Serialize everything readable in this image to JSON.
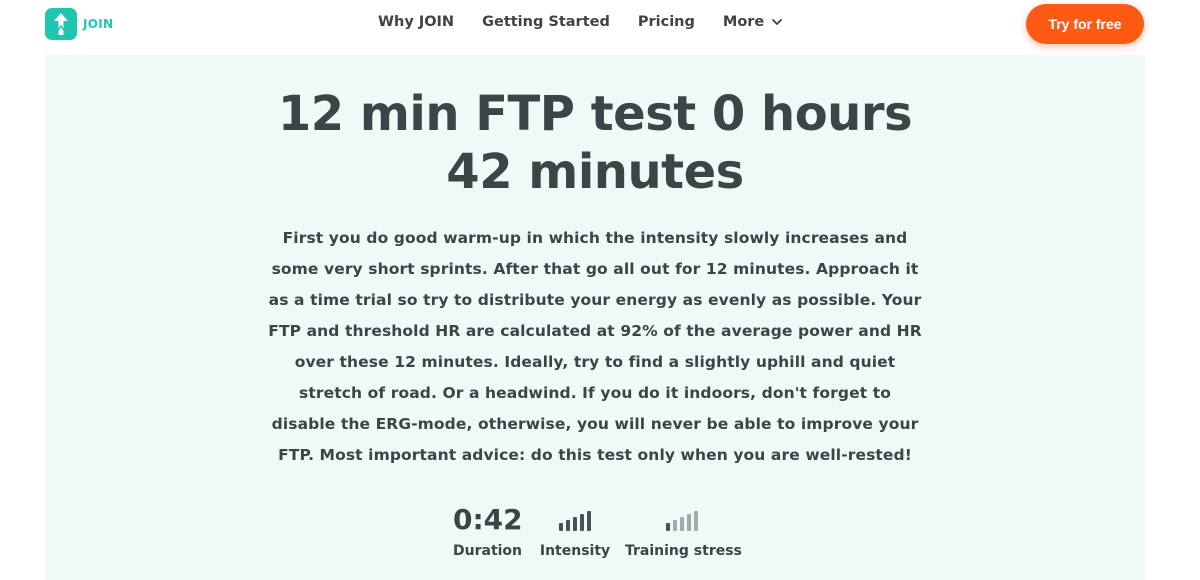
{
  "brand": {
    "name": "JOIN",
    "color": "#1ec6b2",
    "logo_icon": "arrow-up-logo-icon"
  },
  "nav": {
    "items": [
      "Why JOIN",
      "Getting Started",
      "Pricing"
    ],
    "more_label": "More",
    "more_icon": "chevron-down-icon"
  },
  "cta": {
    "label": "Try for free",
    "color": "#ff5a14"
  },
  "hero": {
    "background": "#effaf7",
    "title_line1": "12 min FTP test 0 hours",
    "title_line2": "42 minutes",
    "description": "First you do good warm-up in which the intensity slowly increases and some very short sprints. After that go all out for 12 minutes. Approach it as a time trial so try to distribute your energy as evenly as possible. Your FTP and threshold HR are calculated at 92% of the average power and HR over these 12 minutes. Ideally, try to find a slightly uphill and quiet stretch of road. Or a headwind. If you do it indoors, don't forget to disable the ERG-mode, otherwise, you will never be able to improve your FTP. Most important advice: do this test only when you are well-rested!"
  },
  "stats": {
    "duration": {
      "value": "0:42",
      "label": "Duration"
    },
    "intensity": {
      "label": "Intensity",
      "level": 5,
      "max": 5
    },
    "training_stress": {
      "label": "Training stress",
      "level": 1,
      "max": 5
    }
  }
}
